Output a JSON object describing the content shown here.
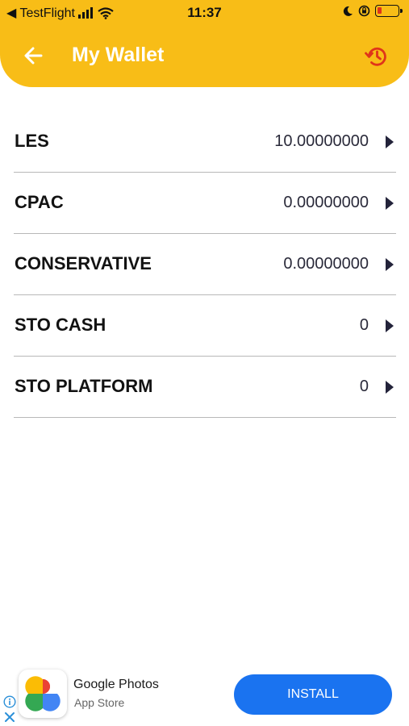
{
  "status_bar": {
    "back_app": "◀ TestFlight",
    "time": "11:37"
  },
  "header": {
    "title": "My Wallet",
    "back_icon": "arrow-left-icon",
    "history_icon": "history-icon",
    "background_color": "#f8bd17",
    "history_icon_color": "#e0341a"
  },
  "wallet": {
    "items": [
      {
        "name": "LES",
        "balance": "10.00000000"
      },
      {
        "name": "CPAC",
        "balance": "0.00000000"
      },
      {
        "name": "CONSERVATIVE",
        "balance": "0.00000000"
      },
      {
        "name": "STO CASH",
        "balance": "0"
      },
      {
        "name": "STO PLATFORM",
        "balance": "0"
      }
    ]
  },
  "ad": {
    "app_name": "Google Photos",
    "store": "App Store",
    "install_label": "INSTALL",
    "install_color": "#1a73f0"
  }
}
